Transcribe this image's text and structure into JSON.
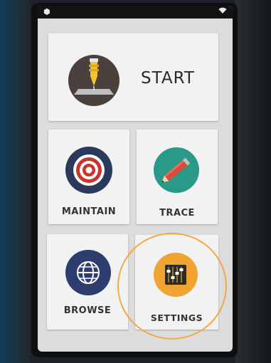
{
  "status_bar": {
    "left_icon": "gear-icon",
    "right_icon": "wifi-icon"
  },
  "menu": {
    "start": {
      "label": "START",
      "icon": "plotter-pen-icon"
    },
    "maintain": {
      "label": "MAINTAIN",
      "icon": "target-icon"
    },
    "trace": {
      "label": "TRACE",
      "icon": "pencil-icon"
    },
    "browse": {
      "label": "BROWSE",
      "icon": "globe-icon"
    },
    "settings": {
      "label": "SETTINGS",
      "icon": "sliders-icon"
    }
  },
  "colors": {
    "start_icon_bg": "#4a403c",
    "maintain_icon_bg": "#2b3a5c",
    "target_red": "#c8352d",
    "trace_icon_bg": "#2a9a88",
    "pencil_red": "#d94a3c",
    "browse_icon_bg": "#2d3e6e",
    "settings_icon_bg": "#f0a532",
    "highlight_ring": "#f3a844"
  }
}
